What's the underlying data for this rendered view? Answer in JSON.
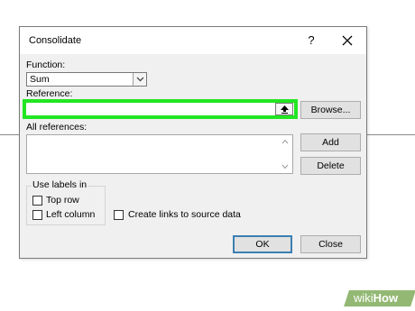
{
  "dialog": {
    "title": "Consolidate",
    "help": "?",
    "function_label": "Function:",
    "function_value": "Sum",
    "reference_label": "Reference:",
    "reference_value": "",
    "browse_label": "Browse...",
    "all_references_label": "All references:",
    "add_label": "Add",
    "delete_label": "Delete",
    "use_labels_in": "Use labels in",
    "top_row_label": "Top row",
    "left_column_label": "Left column",
    "create_links_label": "Create links to source data",
    "ok_label": "OK",
    "close_label": "Close",
    "checkboxes": {
      "top_row": false,
      "left_column": false,
      "create_links": false
    }
  },
  "icons": {
    "close": "close-icon",
    "dropdown": "chevron-down-icon",
    "collapse": "collapse-dialog-icon",
    "scroll_up": "scroll-up-icon",
    "scroll_down": "scroll-down-icon"
  },
  "highlight_color": "#22e622",
  "watermark": {
    "wiki": "wiki",
    "how": "How"
  }
}
